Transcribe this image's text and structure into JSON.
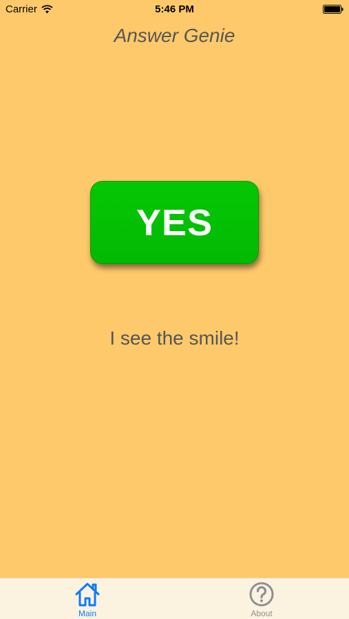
{
  "status_bar": {
    "carrier": "Carrier",
    "time": "5:46 PM"
  },
  "app": {
    "title": "Answer Genie"
  },
  "answer": {
    "label": "YES",
    "color": "#02bd02",
    "text_color": "#ffffff"
  },
  "message": "I see the smile!",
  "tab_bar": {
    "tabs": [
      {
        "label": "Main",
        "icon": "home-icon",
        "selected": true,
        "color": "#0a7aff"
      },
      {
        "label": "About",
        "icon": "question-icon",
        "selected": false,
        "color": "#8e8e93"
      }
    ]
  },
  "colors": {
    "background": "#fec96a",
    "tab_bar_background": "#fbf3df",
    "text": "#555555"
  }
}
